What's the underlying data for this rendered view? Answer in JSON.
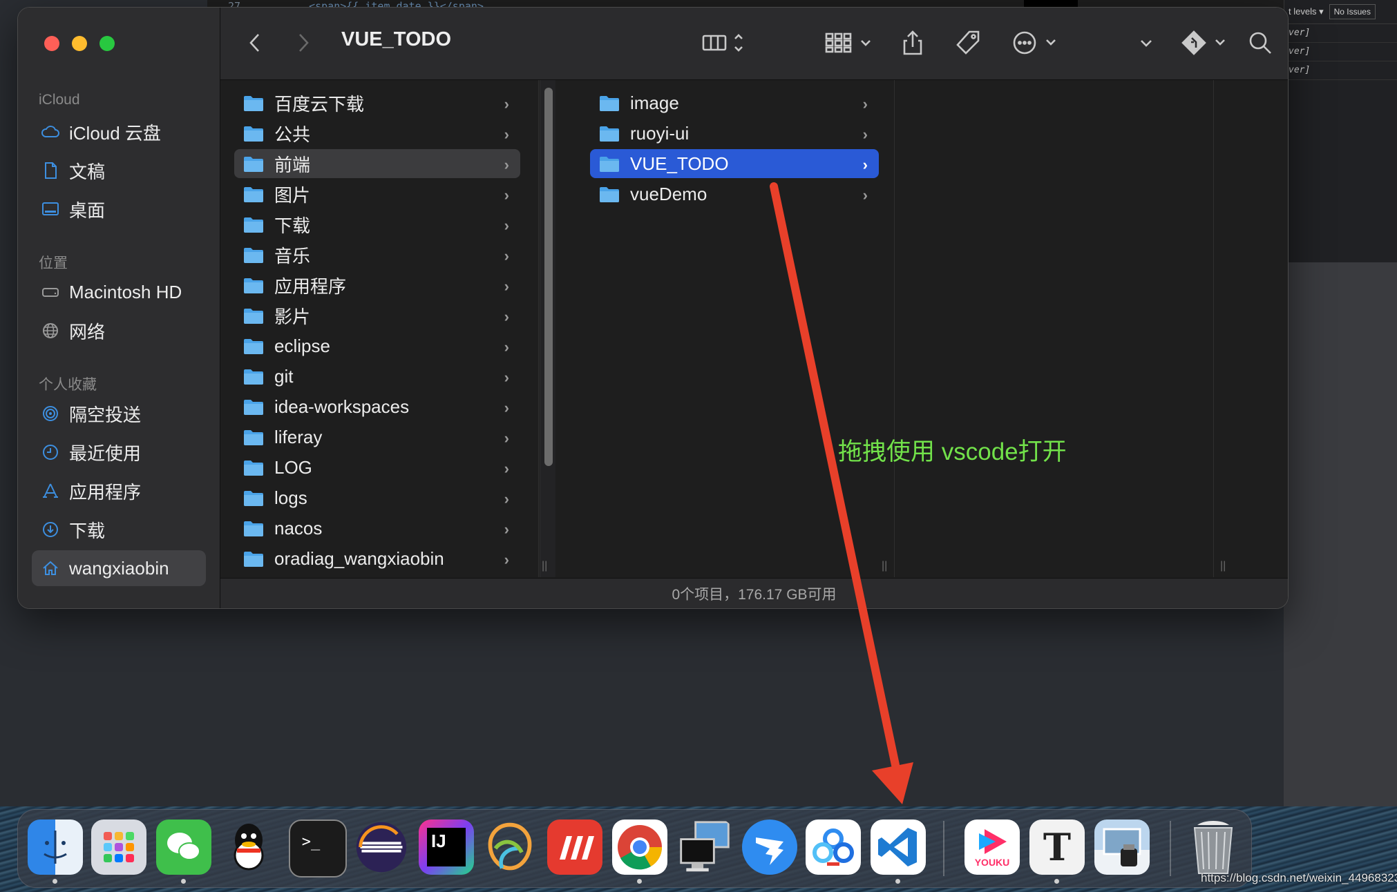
{
  "background": {
    "ide_line_number": "27",
    "ide_code_line": "<span>{{ item.date }}</span>",
    "devtools_levels": "t levels ▾",
    "devtools_issues": "No Issues",
    "devtools_rows": [
      "ver]",
      "ver]",
      "ver]"
    ]
  },
  "finder": {
    "title": "VUE_TODO",
    "sidebar": {
      "sections": [
        {
          "label": "iCloud",
          "items": [
            {
              "label": "iCloud 云盘",
              "icon": "cloud-icon"
            },
            {
              "label": "文稿",
              "icon": "document-icon"
            },
            {
              "label": "桌面",
              "icon": "desktop-icon"
            }
          ]
        },
        {
          "label": "位置",
          "items": [
            {
              "label": "Macintosh HD",
              "icon": "harddrive-icon"
            },
            {
              "label": "网络",
              "icon": "globe-icon"
            }
          ]
        },
        {
          "label": "个人收藏",
          "items": [
            {
              "label": "隔空投送",
              "icon": "airdrop-icon"
            },
            {
              "label": "最近使用",
              "icon": "clock-icon"
            },
            {
              "label": "应用程序",
              "icon": "applications-icon"
            },
            {
              "label": "下载",
              "icon": "download-icon"
            },
            {
              "label": "wangxiaobin",
              "icon": "home-icon",
              "selected": true
            }
          ]
        }
      ]
    },
    "column1": [
      "百度云下载",
      "公共",
      "前端",
      "图片",
      "下载",
      "音乐",
      "应用程序",
      "影片",
      "eclipse",
      "git",
      "idea-workspaces",
      "liferay",
      "LOG",
      "logs",
      "nacos",
      "oradiag_wangxiaobin"
    ],
    "column1_selected": "前端",
    "column2": [
      "image",
      "ruoyi-ui",
      "VUE_TODO",
      "vueDemo"
    ],
    "column2_selected": "VUE_TODO",
    "status": "0个项目，176.17 GB可用"
  },
  "annotation": {
    "text": "拖拽使用 vscode打开",
    "color": "#72e24a",
    "arrow_color": "#e8402a"
  },
  "dock": {
    "apps": [
      {
        "name": "finder",
        "running": true
      },
      {
        "name": "launchpad",
        "running": false
      },
      {
        "name": "wechat",
        "running": true
      },
      {
        "name": "qq",
        "running": false
      },
      {
        "name": "terminal",
        "running": false
      },
      {
        "name": "eclipse",
        "running": false
      },
      {
        "name": "intellij-idea",
        "running": false
      },
      {
        "name": "navicat",
        "running": false
      },
      {
        "name": "xmind",
        "running": false
      },
      {
        "name": "chrome",
        "running": true
      },
      {
        "name": "screen-sharing",
        "running": false
      },
      {
        "name": "dingtalk",
        "running": false
      },
      {
        "name": "baidu-netdisk",
        "running": false
      },
      {
        "name": "vscode",
        "running": true
      },
      {
        "name": "youku",
        "running": false
      },
      {
        "name": "typora",
        "running": true
      },
      {
        "name": "preview",
        "running": false
      },
      {
        "name": "trash",
        "running": false
      }
    ],
    "youku_label": "YOUKU",
    "typora_label": "T",
    "idea_label": "IJ",
    "terminal_label": ">_"
  },
  "watermark": "https://blog.csdn.net/weixin_44968323",
  "colors": {
    "selection": "#2a5ad6",
    "folder": "#4aa3e8",
    "sidebar_icon": "#3d8fe0"
  }
}
